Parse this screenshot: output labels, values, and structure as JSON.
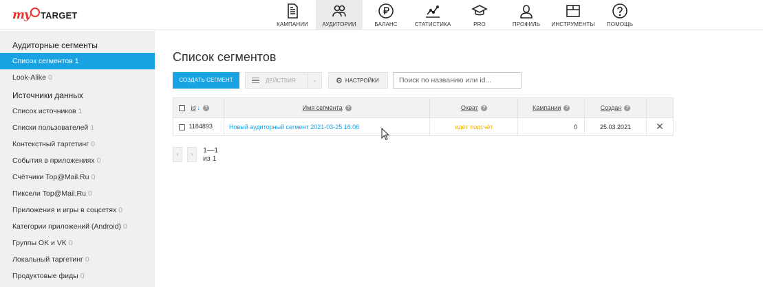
{
  "logo": {
    "my": "my",
    "target": "TARGET"
  },
  "nav": [
    {
      "icon": "campaigns-icon",
      "label": "КАМПАНИИ",
      "active": false
    },
    {
      "icon": "audiences-icon",
      "label": "АУДИТОРИИ",
      "active": true
    },
    {
      "icon": "balance-icon",
      "label": "БАЛАНС",
      "active": false
    },
    {
      "icon": "statistics-icon",
      "label": "СТАТИСТИКА",
      "active": false
    },
    {
      "icon": "pro-icon",
      "label": "PRO",
      "active": false
    },
    {
      "icon": "profile-icon",
      "label": "ПРОФИЛЬ",
      "active": false
    },
    {
      "icon": "tools-icon",
      "label": "ИНСТРУМЕНТЫ",
      "active": false
    },
    {
      "icon": "help-icon",
      "label": "ПОМОЩЬ",
      "active": false
    }
  ],
  "sidebar": {
    "section1": "Аудиторные сегменты",
    "items1": [
      {
        "label": "Список сегментов",
        "count": "1",
        "active": true
      },
      {
        "label": "Look-Alike",
        "count": "0",
        "active": false
      }
    ],
    "section2": "Источники данных",
    "items2": [
      {
        "label": "Список источников",
        "count": "1"
      },
      {
        "label": "Списки пользователей",
        "count": "1"
      },
      {
        "label": "Контекстный таргетинг",
        "count": "0"
      },
      {
        "label": "События в приложениях",
        "count": "0"
      },
      {
        "label": "Счётчики Top@Mail.Ru",
        "count": "0"
      },
      {
        "label": "Пиксели Top@Mail.Ru",
        "count": "0"
      },
      {
        "label": "Приложения и игры в соцсетях",
        "count": "0"
      },
      {
        "label": "Категории приложений (Android)",
        "count": "0"
      },
      {
        "label": "Группы OK и VK",
        "count": "0"
      },
      {
        "label": "Локальный таргетинг",
        "count": "0"
      },
      {
        "label": "Продуктовые фиды",
        "count": "0"
      }
    ]
  },
  "main": {
    "title": "Список сегментов",
    "create_label": "СОЗДАТЬ СЕГМЕНТ",
    "actions_label": "ДЕЙСТВИЯ",
    "settings_label": "НАСТРОЙКИ",
    "search_placeholder": "Поиск по названию или id..."
  },
  "table": {
    "headers": {
      "id": "id",
      "name": "Имя сегмента",
      "reach": "Охват",
      "campaigns": "Кампании",
      "created": "Создан"
    },
    "rows": [
      {
        "id": "1184893",
        "name": "Новый аудиторный сегмент 2021-03-25 16:06",
        "reach": "идёт подсчёт",
        "campaigns": "0",
        "created": "25.03.2021"
      }
    ]
  },
  "pager": {
    "prev": "‹",
    "next": "›",
    "text": "1—1 из 1"
  },
  "colors": {
    "accent": "#1aa3e3",
    "brand": "#e8322d",
    "pending": "#f0b400"
  }
}
